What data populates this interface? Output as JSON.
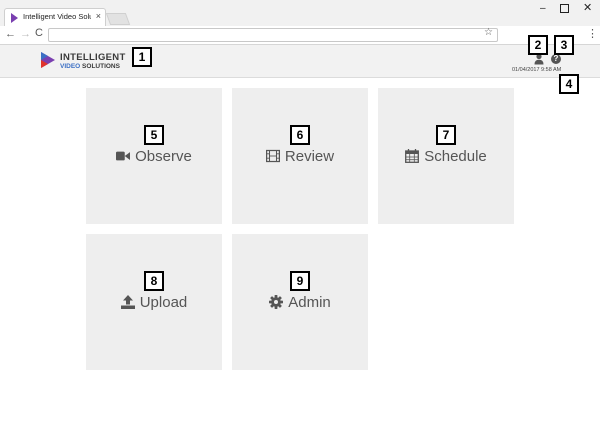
{
  "browser": {
    "tab_title": "Intelligent Video Solutio",
    "tab_close": "×",
    "min_glyph": "–",
    "close_glyph": "✕",
    "back_glyph": "←",
    "forward_glyph": "→",
    "reload_glyph": "C",
    "star_glyph": "☆",
    "menu_glyph": "⋮",
    "address": ""
  },
  "header": {
    "logo_line1": "INTELLIGENT",
    "logo_line2_a": "VIDEO",
    "logo_line2_b": "SOLUTIONS",
    "help_glyph": "?",
    "timestamp": "01/04/2017 9:58 AM"
  },
  "tiles": [
    {
      "label": "Observe",
      "icon": "video-camera-icon"
    },
    {
      "label": "Review",
      "icon": "film-icon"
    },
    {
      "label": "Schedule",
      "icon": "calendar-icon"
    },
    {
      "label": "Upload",
      "icon": "upload-icon"
    },
    {
      "label": "Admin",
      "icon": "gear-icon"
    }
  ],
  "callouts": [
    "1",
    "2",
    "3",
    "4",
    "5",
    "6",
    "7",
    "8",
    "9"
  ],
  "colors": {
    "logo_accent": "#3b6fc4",
    "logo_red": "#e0332c",
    "logo_purple": "#7a3fb0",
    "tile_bg": "#eeeeee",
    "tile_text": "#555555"
  }
}
